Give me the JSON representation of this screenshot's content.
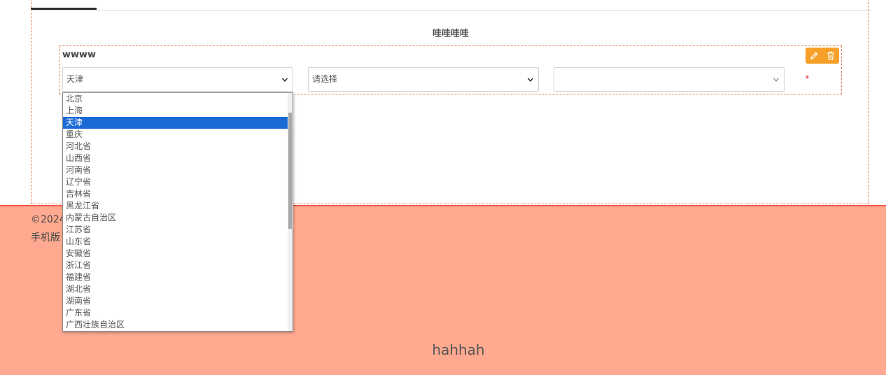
{
  "form": {
    "title": "哇哇哇哇",
    "field_label": "wwww",
    "required_mark": "*"
  },
  "selects": {
    "province_value": "天津",
    "city_placeholder": "请选择",
    "district_value": ""
  },
  "dropdown": {
    "options": [
      "北京",
      "上海",
      "天津",
      "重庆",
      "河北省",
      "山西省",
      "河南省",
      "辽宁省",
      "吉林省",
      "黑龙江省",
      "内蒙古自治区",
      "江苏省",
      "山东省",
      "安徽省",
      "浙江省",
      "福建省",
      "湖北省",
      "湖南省",
      "广东省",
      "广西壮族自治区"
    ],
    "selected": "天津"
  },
  "footer": {
    "copyright": "©2024",
    "mobile_link": "手机版",
    "text": "hahhah",
    "background": "#ffaa90",
    "border": "#ef5a4a"
  },
  "colors": {
    "accent": "#f6a02a",
    "selected_option": "#1a6ad6",
    "dashed_border": "#e37b60"
  },
  "icons": [
    "pencil-icon",
    "trash-icon",
    "chevron-down-icon"
  ]
}
